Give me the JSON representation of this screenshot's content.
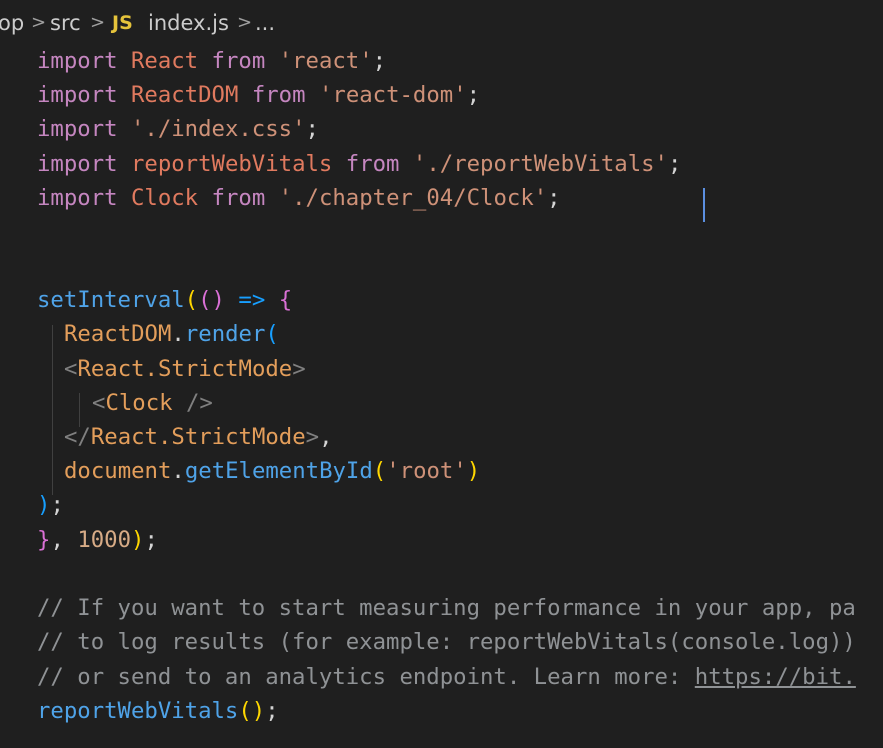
{
  "breadcrumb": {
    "items": [
      "op",
      "src",
      "index.js",
      "..."
    ],
    "file_icon_text": "JS",
    "separator": ">"
  },
  "code": {
    "line1": {
      "kw": "import",
      "id": "React",
      "from": "from",
      "str": "'react'",
      "end": ";"
    },
    "line2": {
      "kw": "import",
      "id": "ReactDOM",
      "from": "from",
      "str": "'react-dom'",
      "end": ";"
    },
    "line3": {
      "kw": "import",
      "str": "'./index.css'",
      "end": ";"
    },
    "line4": {
      "kw": "import",
      "id": "reportWebVitals",
      "from": "from",
      "str": "'./reportWebVitals'",
      "end": ";"
    },
    "line5": {
      "kw": "import",
      "id": "Clock",
      "from": "from",
      "str": "'./chapter_04/Clock'",
      "end": ";"
    },
    "line8": {
      "fn": "setInterval",
      "open": "(",
      "args": "()",
      "arrow": "=>",
      "brace": "{"
    },
    "line9": {
      "obj": "ReactDOM",
      "dot": ".",
      "fn": "render",
      "open": "("
    },
    "line10": {
      "lt": "<",
      "name": "React.StrictMode",
      "gt": ">"
    },
    "line11": {
      "lt": "<",
      "name": "Clock",
      "close": "/>"
    },
    "line12": {
      "lt": "</",
      "name": "React.StrictMode",
      "gt": ">",
      "comma": ","
    },
    "line13": {
      "obj": "document",
      "dot": ".",
      "fn": "getElementById",
      "open": "(",
      "str": "'root'",
      "close": ")"
    },
    "line14": {
      "close": ")",
      "end": ";"
    },
    "line15": {
      "brace": "}",
      "comma": ",",
      "num": "1000",
      "close": ")",
      "end": ";"
    },
    "line17": "// If you want to start measuring performance in your app, pa",
    "line18": "// to log results (for example: reportWebVitals(console.log))",
    "line19_text": "// or send to an analytics endpoint. Learn more: ",
    "line19_link": "https://bit.",
    "line20": {
      "fn": "reportWebVitals",
      "parens": "()",
      "end": ";"
    }
  },
  "colors": {
    "background": "#1f1f1f",
    "keyword": "#c586c0",
    "string": "#ce9178",
    "function": "#4fa3e8",
    "comment": "#8f9295",
    "cursor": "#5b8fe0"
  }
}
